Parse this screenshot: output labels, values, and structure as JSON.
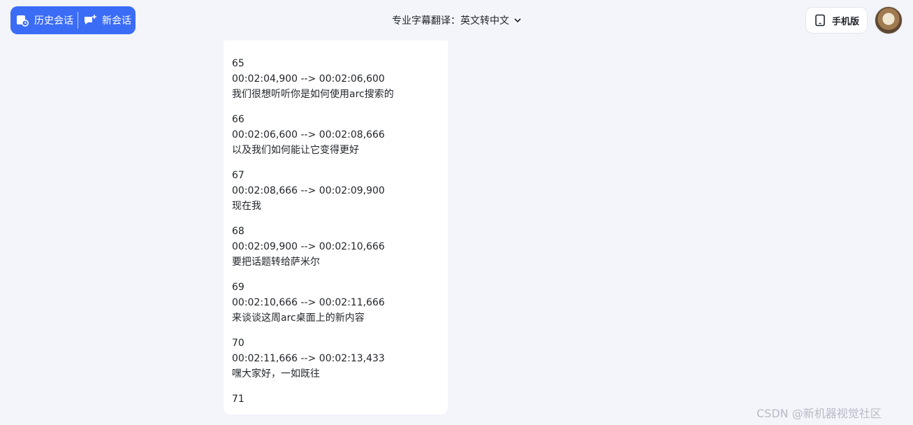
{
  "header": {
    "history_label": "历史会话",
    "new_chat_label": "新会话",
    "title": "专业字幕翻译：英文转中文",
    "mobile_label": "手机版"
  },
  "subtitles": [
    {
      "index": "65",
      "time": "00:02:04,900 --> 00:02:06,600",
      "text": "我们很想听听你是如何使用arc搜索的"
    },
    {
      "index": "66",
      "time": "00:02:06,600 --> 00:02:08,666",
      "text": "以及我们如何能让它变得更好"
    },
    {
      "index": "67",
      "time": "00:02:08,666 --> 00:02:09,900",
      "text": "现在我"
    },
    {
      "index": "68",
      "time": "00:02:09,900 --> 00:02:10,666",
      "text": "要把话题转给萨米尔"
    },
    {
      "index": "69",
      "time": "00:02:10,666 --> 00:02:11,666",
      "text": "来谈谈这周arc桌面上的新内容"
    },
    {
      "index": "70",
      "time": "00:02:11,666 --> 00:02:13,433",
      "text": "嘿大家好，一如既往"
    },
    {
      "index": "71",
      "time": "",
      "text": ""
    }
  ],
  "watermark": "CSDN @新机器视觉社区",
  "colors": {
    "accent": "#3a6cf6",
    "background": "#f4f5fb"
  }
}
